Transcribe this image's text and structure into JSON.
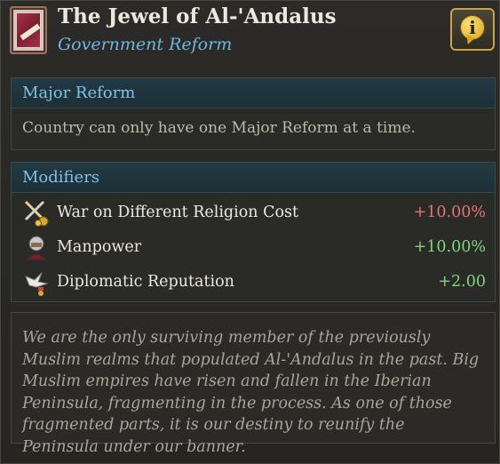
{
  "header": {
    "title": "The Jewel of Al-'Andalus",
    "subtitle": "Government Reform",
    "info_icon_glyph": "i"
  },
  "major_reform": {
    "heading": "Major Reform",
    "text": "Country can only have one Major Reform at a time."
  },
  "modifiers": {
    "heading": "Modifiers",
    "items": [
      {
        "label": "War on Different Religion Cost",
        "value": "+10.00%",
        "icon": "crossed-swords-icon",
        "tone": "negative"
      },
      {
        "label": "Manpower",
        "value": "+10.00%",
        "icon": "soldier-icon",
        "tone": "positive"
      },
      {
        "label": "Diplomatic Reputation",
        "value": "+2.00",
        "icon": "dove-icon",
        "tone": "positive"
      }
    ]
  },
  "description": "We are the only surviving member of the previously Muslim realms that populated Al-'Andalus in the past. Big Muslim empires have risen and fallen in the Iberian Peninsula, fragmenting in the process. As one of those fragmented parts, it is our destiny to reunify the Peninsula under our banner.",
  "colors": {
    "accent_blue": "#6db7de",
    "negative": "#e07575",
    "positive": "#7fd67f",
    "gold": "#c9a24a"
  }
}
